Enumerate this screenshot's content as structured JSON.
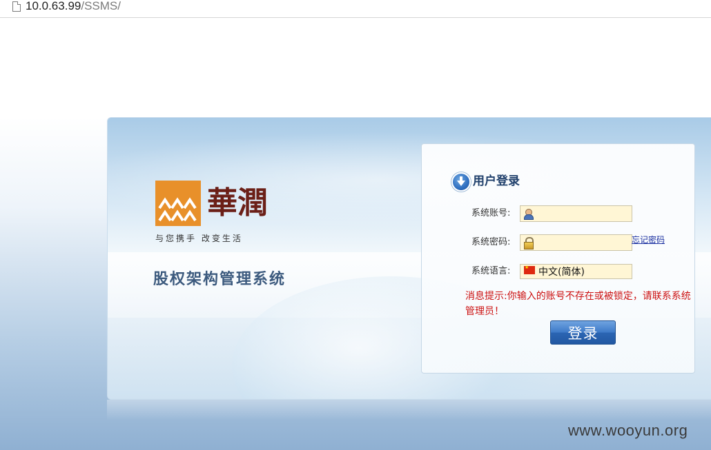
{
  "browser": {
    "url_host": "10.0.63.99",
    "url_path": "/SSMS/"
  },
  "branding": {
    "logo_text": "華潤",
    "slogan": "与您携手  改变生活",
    "system_title": "股权架构管理系统",
    "logo_color": "#e8902a"
  },
  "login": {
    "title": "用户登录",
    "account_label": "系统账号:",
    "account_value": "",
    "password_label": "系统密码:",
    "password_value": "",
    "forgot_password": "忘记密码",
    "language_label": "系统语言:",
    "language_value": "中文(简体)",
    "error_message": "消息提示:你输入的账号不存在或被锁定，请联系系统管理员！",
    "submit_label": "登录"
  },
  "watermark": "www.wooyun.org",
  "colors": {
    "error": "#cc1111",
    "button": "#2f6fc0",
    "input_bg": "#fff6d5"
  }
}
